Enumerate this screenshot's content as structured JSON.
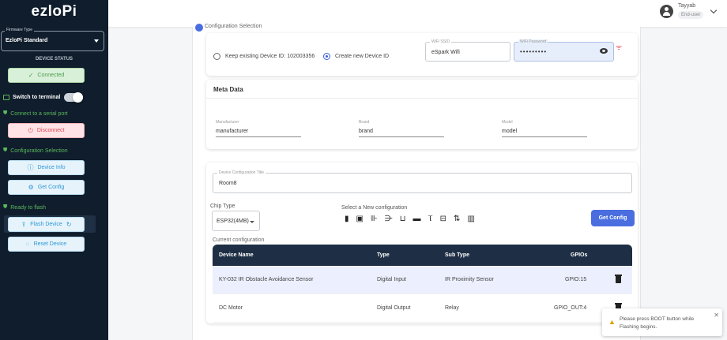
{
  "sidebar": {
    "logo": "ezloPi",
    "firmware_label": "Firmware Type",
    "firmware_value": "EzloPi Standard",
    "device_status_label": "DEVICE STATUS",
    "connected_label": "Connected",
    "switch_terminal_label": "Switch to terminal",
    "connect_serial_label": "Connect to a serial port",
    "disconnect_label": "Disconnect",
    "config_selection_label": "Configuration Selection",
    "device_info_label": "Device Info",
    "get_config_label": "Get Config",
    "ready_flash_label": "Ready to flash",
    "flash_device_label": "Flash Device",
    "reset_device_label": "Reset Device"
  },
  "user": {
    "name": "Tayyab",
    "role": "End-user"
  },
  "step_title": "Configuration Selection",
  "device_id": {
    "keep_label": "Keep existing Device ID: 102003356",
    "create_label": "Create new Device ID",
    "wifi_ssid_label": "WiFi SSID",
    "wifi_ssid_value": "eSpark Wifi",
    "wifi_password_label": "WiFi Password",
    "wifi_password_value": "•••••••••"
  },
  "meta": {
    "title": "Meta Data",
    "manufacturer_label": "Manufacturer",
    "manufacturer_value": "manufacturer",
    "brand_label": "Brand",
    "brand_value": "brand",
    "model_label": "Model",
    "model_value": "model"
  },
  "device_config": {
    "title_label": "Device Configuration Title",
    "title_value": "Room8",
    "chip_type_label": "Chip Type",
    "chip_type_value": "ESP32(4MB)",
    "new_config_label": "Select a New configuration",
    "get_config_button": "Get Config",
    "current_config_label": "Current configuration",
    "icons": [
      "digital-output-icon",
      "digital-input-icon",
      "analog-input-icon",
      "analog-output-icon",
      "pwm-icon",
      "uart-icon",
      "onewire-icon",
      "i2c-icon",
      "spi-icon",
      "other-icon"
    ]
  },
  "table": {
    "headers": [
      "Device Name",
      "Type",
      "Sub Type",
      "GPIOs"
    ],
    "rows": [
      {
        "name": "KY-032 IR Obstacle Avoidance Sensor",
        "type": "Digital Input",
        "subtype": "IR Proximity Sensor",
        "gpio": "GPIO:15"
      },
      {
        "name": "DC Motor",
        "type": "Digital Output",
        "subtype": "Relay",
        "gpio": "GPIO_OUT:4"
      }
    ]
  },
  "toast": {
    "message": "Please press BOOT button while Flashing begins."
  },
  "colors": {
    "sidebar_bg": "#0f1d2c",
    "accent": "#4a6ee0",
    "success": "#5cb85c",
    "danger": "#e34a5a",
    "table_header": "#1e2e44"
  }
}
